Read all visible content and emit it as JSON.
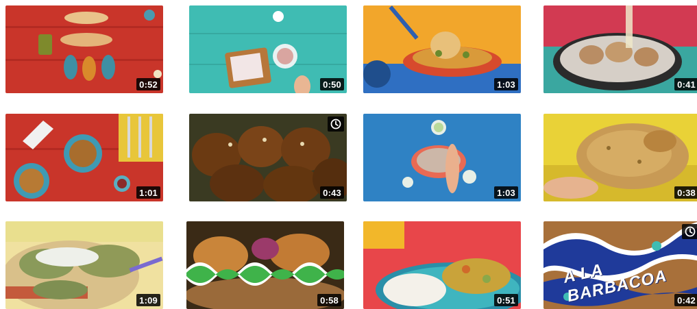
{
  "videos": [
    {
      "duration": "0:52",
      "watch_later": false
    },
    {
      "duration": "0:50",
      "watch_later": false
    },
    {
      "duration": "1:03",
      "watch_later": false
    },
    {
      "duration": "0:41",
      "watch_later": false
    },
    {
      "duration": "1:01",
      "watch_later": false
    },
    {
      "duration": "0:43",
      "watch_later": true
    },
    {
      "duration": "1:03",
      "watch_later": false
    },
    {
      "duration": "0:38",
      "watch_later": false
    },
    {
      "duration": "1:09",
      "watch_later": false
    },
    {
      "duration": "0:58",
      "watch_later": false
    },
    {
      "duration": "0:51",
      "watch_later": false
    },
    {
      "duration": "0:42",
      "watch_later": true,
      "title_overlay": "A LA BARBACOA"
    }
  ],
  "icons": {
    "watch_later": "clock-icon"
  }
}
